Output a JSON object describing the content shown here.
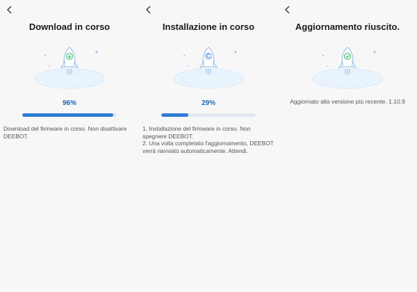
{
  "colors": {
    "accent": "#2f7ad6",
    "percent_text": "#1e67b8",
    "success_check": "#3fb96b",
    "track": "#e2e8f0",
    "background": "#f7f7f7"
  },
  "icons": {
    "back": "chevron-left-icon",
    "rocket": "rocket-icon",
    "download": "download-arrow-icon",
    "success": "checkmark-icon"
  },
  "screens": [
    {
      "title": "Download in corso",
      "progress_label": "96%",
      "progress_value": 0.96,
      "message_lines": [
        "Download del firmware in corso. Non disattivare DEEBOT."
      ]
    },
    {
      "title": "Installazione in corso",
      "progress_label": "29%",
      "progress_value": 0.29,
      "message_lines": [
        "1. Installazione del firmware in corso. Non spegnere DEEBOT.",
        "2. Una volta completato l'aggiornamento, DEEBOT verrà riavviato automaticamente. Attendi."
      ]
    },
    {
      "title": "Aggiornamento riuscito.",
      "message": "Aggiornato alla versione più recente. 1.10.9"
    }
  ]
}
